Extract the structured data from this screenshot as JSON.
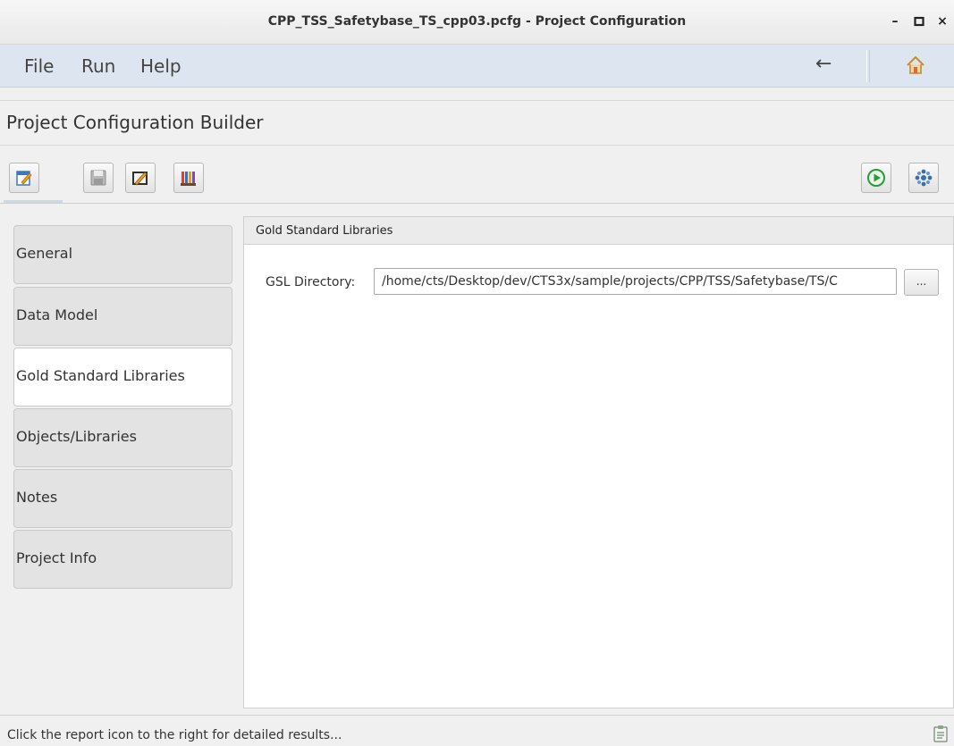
{
  "window": {
    "title": "CPP_TSS_Safetybase_TS_cpp03.pcfg - Project Configuration",
    "minimize": "–",
    "maximize": "□",
    "close": "×"
  },
  "menu": {
    "items": [
      "File",
      "Run",
      "Help"
    ],
    "back_icon": "←"
  },
  "builder": {
    "title": "Project Configuration Builder"
  },
  "toolbar": {
    "left_icons": [
      "edit-config-icon",
      "save-icon",
      "edit-library-icon",
      "report-books-icon"
    ],
    "right_icons": [
      "run-icon",
      "settings-icon"
    ]
  },
  "nav": {
    "tabs": [
      {
        "label": "General",
        "active": false
      },
      {
        "label": "Data Model",
        "active": false
      },
      {
        "label": "Gold Standard Libraries",
        "active": true
      },
      {
        "label": "Objects/Libraries",
        "active": false
      },
      {
        "label": "Notes",
        "active": false
      },
      {
        "label": "Project Info",
        "active": false
      }
    ]
  },
  "panel": {
    "title": "Gold Standard Libraries",
    "gsl_label": "GSL Directory:",
    "gsl_value": "/home/cts/Desktop/dev/CTS3x/sample/projects/CPP/TSS/Safetybase/TS/C",
    "browse_label": "..."
  },
  "status": {
    "text": "Click the report icon to the right for detailed results..."
  }
}
